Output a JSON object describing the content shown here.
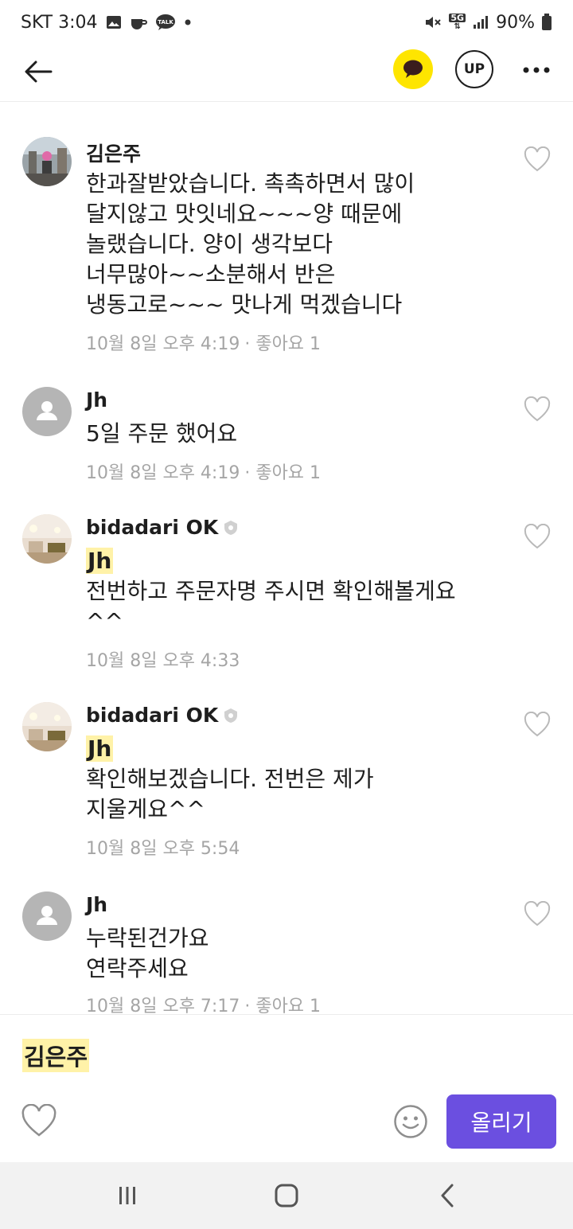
{
  "status": {
    "carrier_time": "SKT 3:04",
    "network": "5G",
    "battery": "90%",
    "icons": [
      "image-icon",
      "coffee-icon",
      "talk-icon",
      "dot-icon",
      "mute-icon",
      "signal-icon",
      "battery-icon"
    ]
  },
  "header": {
    "back_icon": "arrow-left-icon",
    "talk_icon": "chat-bubble-icon",
    "up_label": "UP",
    "more_label": "•••",
    "colors": {
      "talk_bg": "#fee500"
    }
  },
  "comments": [
    {
      "author": "김은주",
      "avatar": "photo",
      "verified": false,
      "mention": "",
      "lines": [
        "한과잘받았습니다. 촉촉하면서  많이",
        "달지않고  맛잇네요~~~양 때문에",
        "놀랬습니다. 양이 생각보다",
        "너무많아~~소분해서 반은",
        "냉동고로~~~ 맛나게 먹겠습니다"
      ],
      "time": "10월 8일 오후 4:19",
      "likes": "· 좋아요 1"
    },
    {
      "author": "Jh",
      "avatar": "default",
      "verified": false,
      "mention": "",
      "lines": [
        "5일 주문 했어요"
      ],
      "time": "10월 8일 오후 4:19",
      "likes": "· 좋아요 1"
    },
    {
      "author": "bidadari OK",
      "avatar": "photo",
      "verified": true,
      "mention": "Jh",
      "lines": [
        "전번하고 주문자명 주시면 확인해볼게요",
        "^^"
      ],
      "time": "10월 8일 오후 4:33",
      "likes": ""
    },
    {
      "author": "bidadari OK",
      "avatar": "photo",
      "verified": true,
      "mention": "Jh",
      "lines": [
        "확인해보겠습니다. 전번은 제가",
        "지울게요^^"
      ],
      "time": "10월 8일 오후 5:54",
      "likes": ""
    },
    {
      "author": "Jh",
      "avatar": "default",
      "verified": false,
      "mention": "",
      "lines": [
        "누락된건가요",
        "연락주세요"
      ],
      "time": "10월 8일 오후 7:17",
      "likes": "· 좋아요 1"
    }
  ],
  "composer": {
    "mention": "김은주",
    "submit_label": "올리기",
    "colors": {
      "submit_bg": "#6b4fe0",
      "mention_bg": "#fff2a8"
    }
  },
  "nav": {
    "recents_label": "|||",
    "icons": [
      "recents-icon",
      "home-icon",
      "back-icon"
    ]
  }
}
